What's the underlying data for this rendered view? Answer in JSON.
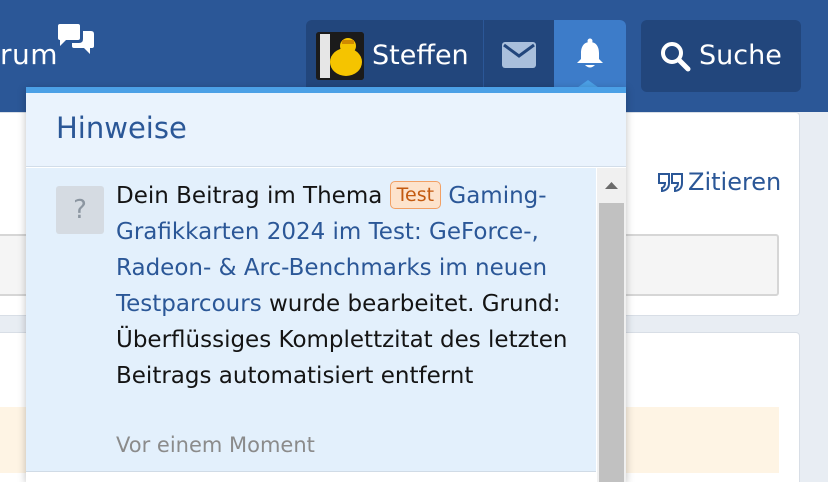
{
  "header": {
    "forum_title_fragment": "rum",
    "user_name": "Steffen",
    "search_label": "Suche",
    "colors": {
      "bar": "#2b5797",
      "active": "#3d7cc9",
      "accent": "#4ba0e6"
    }
  },
  "background": {
    "quote_label": "Zitieren"
  },
  "notifications": {
    "title": "Hinweise",
    "items": [
      {
        "avatar_placeholder": "?",
        "prefix": "Dein Beitrag im Thema ",
        "label": "Test",
        "thread_title": "Gaming-Grafikkarten 2024 im Test: GeForce-, Radeon- & Arc-Benchmarks im neuen Testparcours",
        "suffix": " wurde bearbeitet. Grund: Überflüssiges Komplettzitat des letzten Beitrags automatisiert entfernt",
        "time": "Vor einem Moment"
      }
    ]
  },
  "icons": [
    "chat-icon",
    "envelope-icon",
    "bell-icon",
    "search-icon",
    "quote-icon",
    "scroll-up-icon"
  ]
}
